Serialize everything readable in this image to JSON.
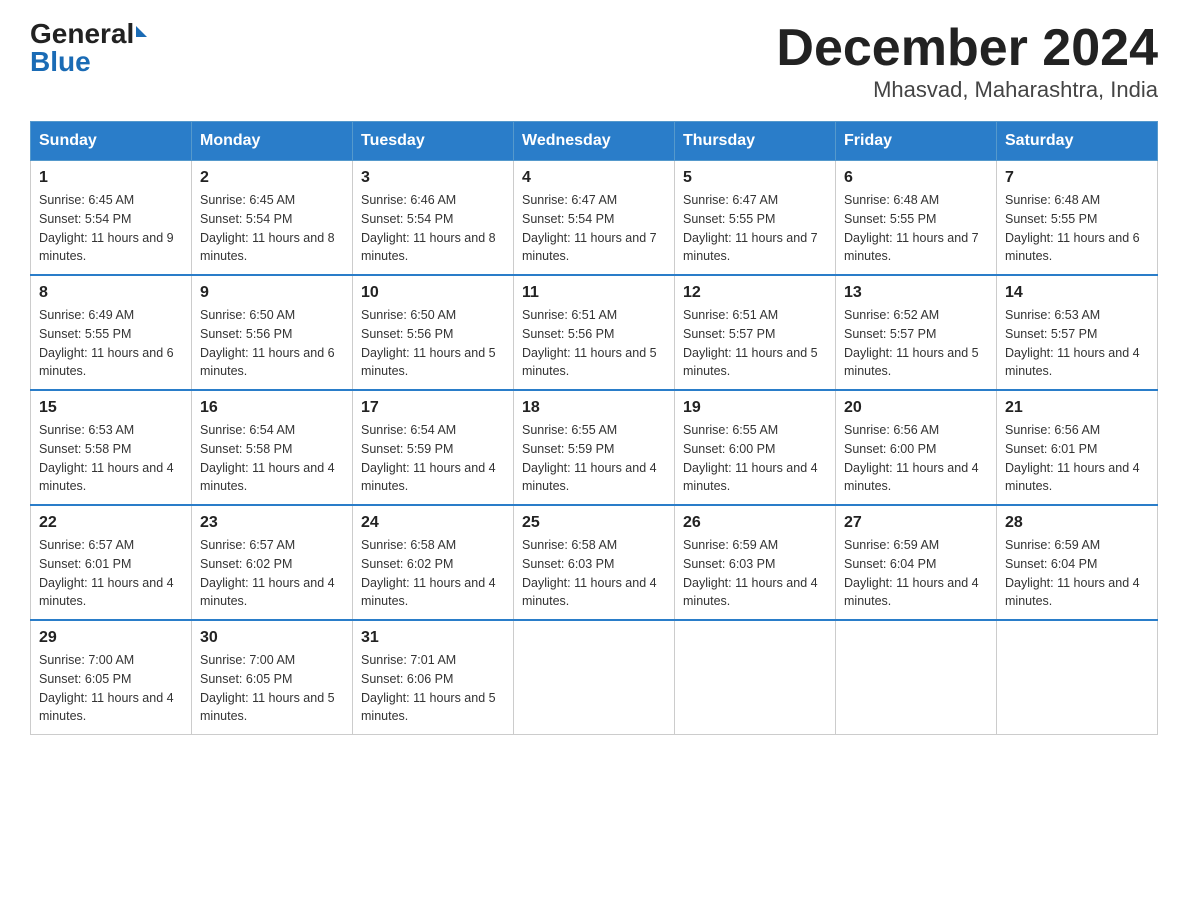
{
  "header": {
    "logo_main": "General",
    "logo_sub": "Blue",
    "title": "December 2024",
    "subtitle": "Mhasvad, Maharashtra, India"
  },
  "days_of_week": [
    "Sunday",
    "Monday",
    "Tuesday",
    "Wednesday",
    "Thursday",
    "Friday",
    "Saturday"
  ],
  "weeks": [
    [
      {
        "day": "1",
        "sunrise": "6:45 AM",
        "sunset": "5:54 PM",
        "daylight": "11 hours and 9 minutes."
      },
      {
        "day": "2",
        "sunrise": "6:45 AM",
        "sunset": "5:54 PM",
        "daylight": "11 hours and 8 minutes."
      },
      {
        "day": "3",
        "sunrise": "6:46 AM",
        "sunset": "5:54 PM",
        "daylight": "11 hours and 8 minutes."
      },
      {
        "day": "4",
        "sunrise": "6:47 AM",
        "sunset": "5:54 PM",
        "daylight": "11 hours and 7 minutes."
      },
      {
        "day": "5",
        "sunrise": "6:47 AM",
        "sunset": "5:55 PM",
        "daylight": "11 hours and 7 minutes."
      },
      {
        "day": "6",
        "sunrise": "6:48 AM",
        "sunset": "5:55 PM",
        "daylight": "11 hours and 7 minutes."
      },
      {
        "day": "7",
        "sunrise": "6:48 AM",
        "sunset": "5:55 PM",
        "daylight": "11 hours and 6 minutes."
      }
    ],
    [
      {
        "day": "8",
        "sunrise": "6:49 AM",
        "sunset": "5:55 PM",
        "daylight": "11 hours and 6 minutes."
      },
      {
        "day": "9",
        "sunrise": "6:50 AM",
        "sunset": "5:56 PM",
        "daylight": "11 hours and 6 minutes."
      },
      {
        "day": "10",
        "sunrise": "6:50 AM",
        "sunset": "5:56 PM",
        "daylight": "11 hours and 5 minutes."
      },
      {
        "day": "11",
        "sunrise": "6:51 AM",
        "sunset": "5:56 PM",
        "daylight": "11 hours and 5 minutes."
      },
      {
        "day": "12",
        "sunrise": "6:51 AM",
        "sunset": "5:57 PM",
        "daylight": "11 hours and 5 minutes."
      },
      {
        "day": "13",
        "sunrise": "6:52 AM",
        "sunset": "5:57 PM",
        "daylight": "11 hours and 5 minutes."
      },
      {
        "day": "14",
        "sunrise": "6:53 AM",
        "sunset": "5:57 PM",
        "daylight": "11 hours and 4 minutes."
      }
    ],
    [
      {
        "day": "15",
        "sunrise": "6:53 AM",
        "sunset": "5:58 PM",
        "daylight": "11 hours and 4 minutes."
      },
      {
        "day": "16",
        "sunrise": "6:54 AM",
        "sunset": "5:58 PM",
        "daylight": "11 hours and 4 minutes."
      },
      {
        "day": "17",
        "sunrise": "6:54 AM",
        "sunset": "5:59 PM",
        "daylight": "11 hours and 4 minutes."
      },
      {
        "day": "18",
        "sunrise": "6:55 AM",
        "sunset": "5:59 PM",
        "daylight": "11 hours and 4 minutes."
      },
      {
        "day": "19",
        "sunrise": "6:55 AM",
        "sunset": "6:00 PM",
        "daylight": "11 hours and 4 minutes."
      },
      {
        "day": "20",
        "sunrise": "6:56 AM",
        "sunset": "6:00 PM",
        "daylight": "11 hours and 4 minutes."
      },
      {
        "day": "21",
        "sunrise": "6:56 AM",
        "sunset": "6:01 PM",
        "daylight": "11 hours and 4 minutes."
      }
    ],
    [
      {
        "day": "22",
        "sunrise": "6:57 AM",
        "sunset": "6:01 PM",
        "daylight": "11 hours and 4 minutes."
      },
      {
        "day": "23",
        "sunrise": "6:57 AM",
        "sunset": "6:02 PM",
        "daylight": "11 hours and 4 minutes."
      },
      {
        "day": "24",
        "sunrise": "6:58 AM",
        "sunset": "6:02 PM",
        "daylight": "11 hours and 4 minutes."
      },
      {
        "day": "25",
        "sunrise": "6:58 AM",
        "sunset": "6:03 PM",
        "daylight": "11 hours and 4 minutes."
      },
      {
        "day": "26",
        "sunrise": "6:59 AM",
        "sunset": "6:03 PM",
        "daylight": "11 hours and 4 minutes."
      },
      {
        "day": "27",
        "sunrise": "6:59 AM",
        "sunset": "6:04 PM",
        "daylight": "11 hours and 4 minutes."
      },
      {
        "day": "28",
        "sunrise": "6:59 AM",
        "sunset": "6:04 PM",
        "daylight": "11 hours and 4 minutes."
      }
    ],
    [
      {
        "day": "29",
        "sunrise": "7:00 AM",
        "sunset": "6:05 PM",
        "daylight": "11 hours and 4 minutes."
      },
      {
        "day": "30",
        "sunrise": "7:00 AM",
        "sunset": "6:05 PM",
        "daylight": "11 hours and 5 minutes."
      },
      {
        "day": "31",
        "sunrise": "7:01 AM",
        "sunset": "6:06 PM",
        "daylight": "11 hours and 5 minutes."
      },
      null,
      null,
      null,
      null
    ]
  ]
}
